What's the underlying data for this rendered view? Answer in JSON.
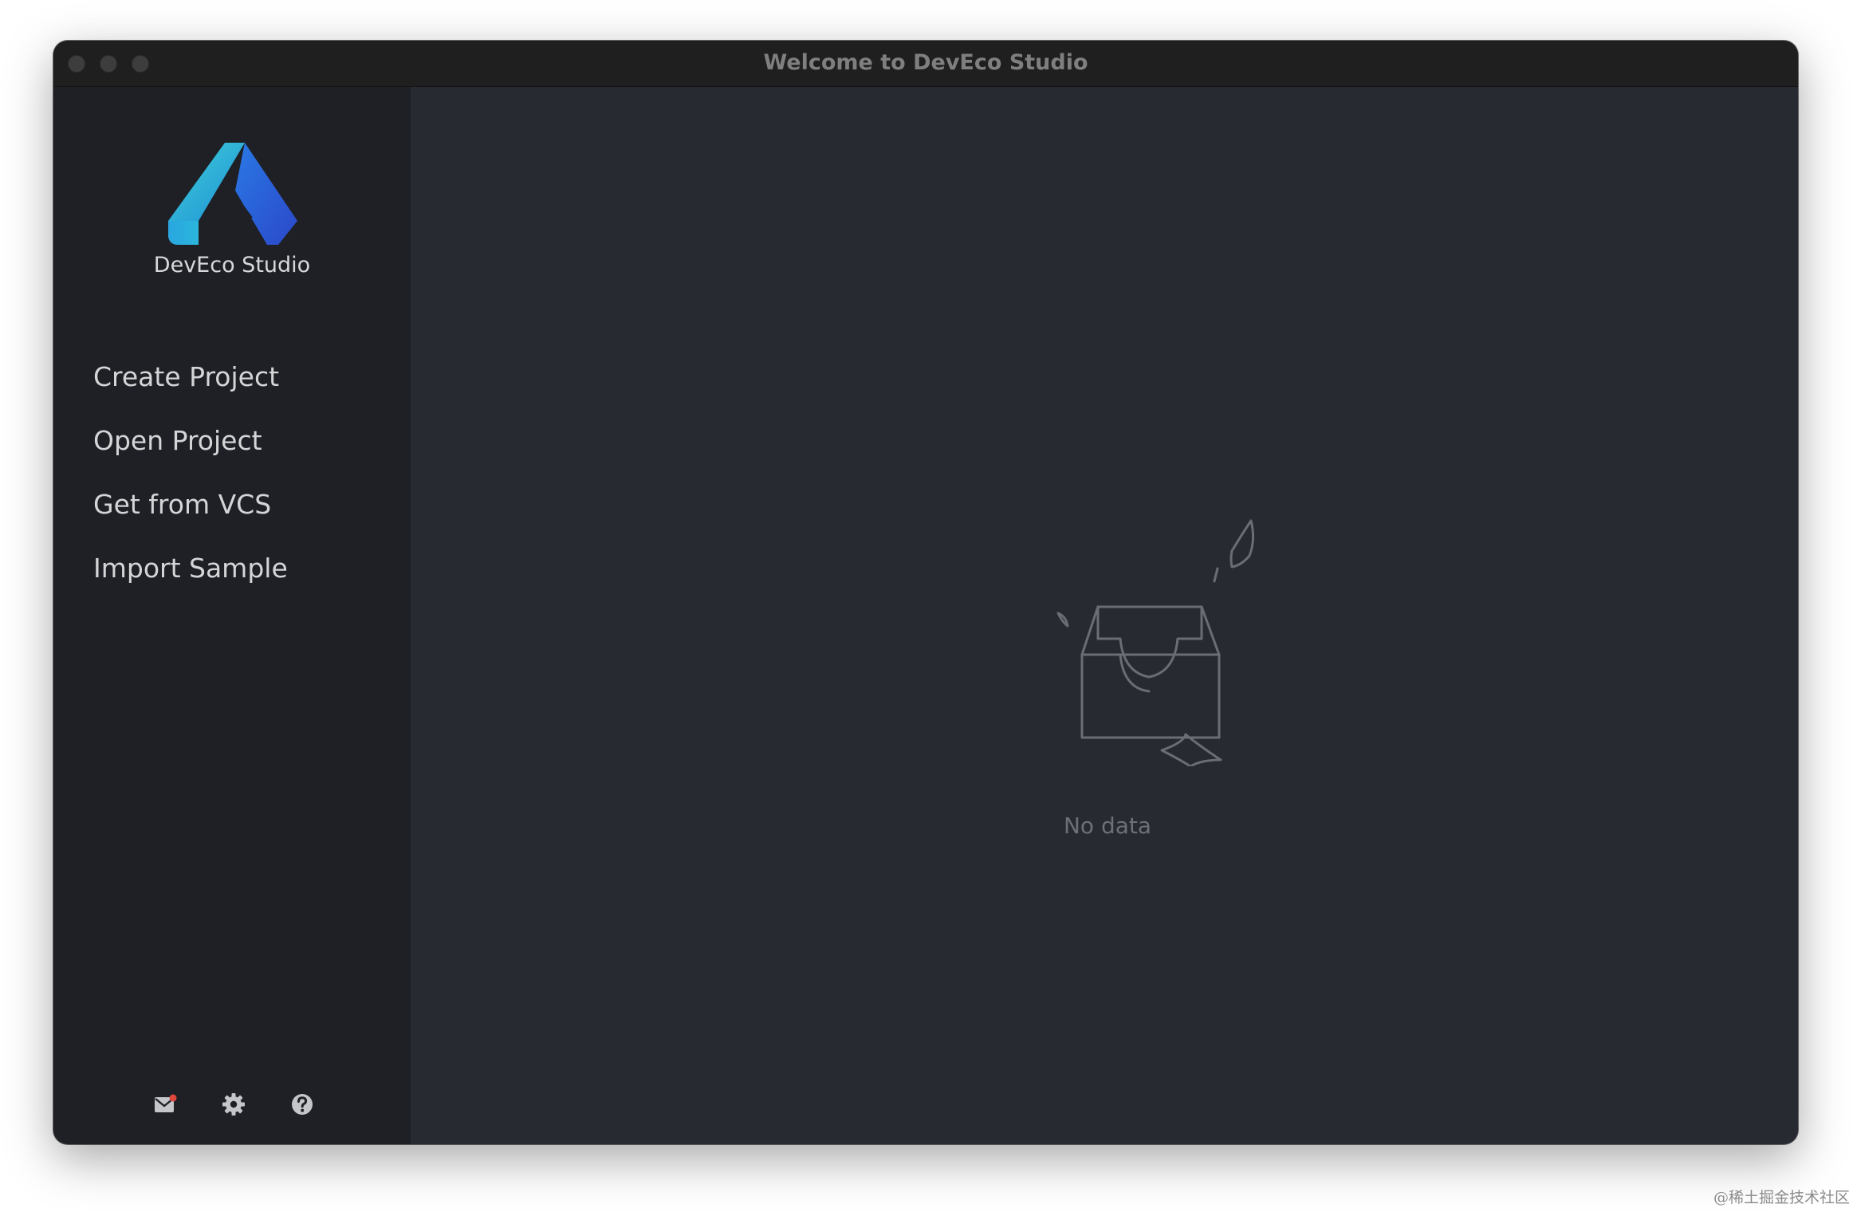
{
  "window": {
    "title": "Welcome to DevEco Studio"
  },
  "sidebar": {
    "app_name": "DevEco Studio",
    "logo_icon": "deveco-logo-icon",
    "items": [
      {
        "label": "Create Project"
      },
      {
        "label": "Open Project"
      },
      {
        "label": "Get from VCS"
      },
      {
        "label": "Import Sample"
      }
    ],
    "bottom_icons": [
      "mail-icon",
      "gear-icon",
      "help-icon"
    ]
  },
  "main": {
    "empty_state_icon": "empty-inbox-icon",
    "empty_text": "No data"
  },
  "watermark": "@稀土掘金技术社区",
  "colors": {
    "titlebar": "#1f1f1f",
    "sidebar": "#1e2026",
    "main": "#272a31",
    "logo_light": "#37c7d7",
    "logo_dark": "#2f63e0",
    "notification_dot": "#e0483e"
  }
}
